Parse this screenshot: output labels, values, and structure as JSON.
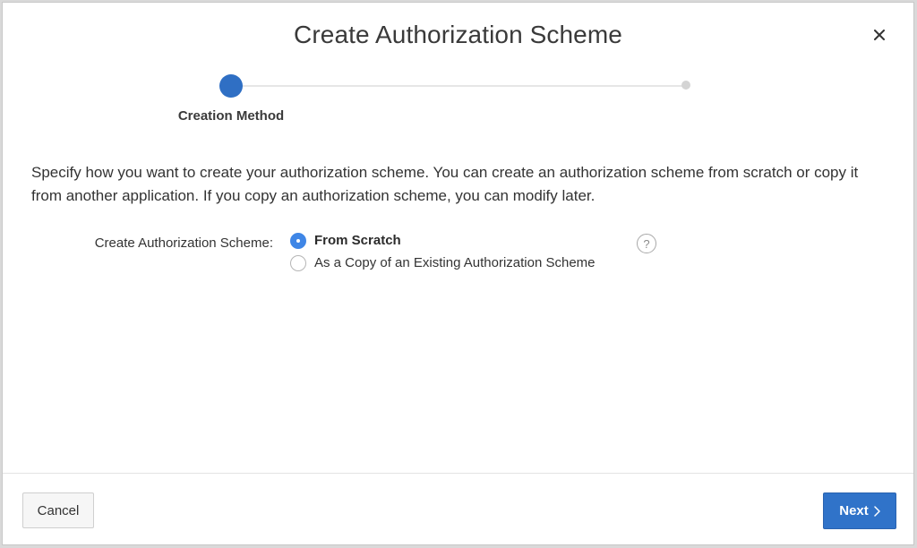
{
  "dialog": {
    "title": "Create Authorization Scheme",
    "close_icon": "close-icon"
  },
  "wizard": {
    "steps": [
      {
        "label": "Creation Method",
        "state": "current"
      },
      {
        "label": "",
        "state": "upcoming"
      }
    ]
  },
  "description": "Specify how you want to create your authorization scheme. You can create an authorization scheme from scratch or copy it from another application. If you copy an authorization scheme, you can modify later.",
  "form": {
    "field_label": "Create Authorization Scheme:",
    "options": [
      {
        "label": "From Scratch",
        "selected": true
      },
      {
        "label": "As a Copy of an Existing Authorization Scheme",
        "selected": false
      }
    ],
    "help_icon": "help-icon",
    "help_glyph": "?"
  },
  "footer": {
    "cancel_label": "Cancel",
    "next_label": "Next",
    "next_icon": "chevron-right-icon"
  },
  "colors": {
    "primary": "#3073c9",
    "wizard_current": "#2f6fc4",
    "radio_selected": "#3f86e6"
  }
}
